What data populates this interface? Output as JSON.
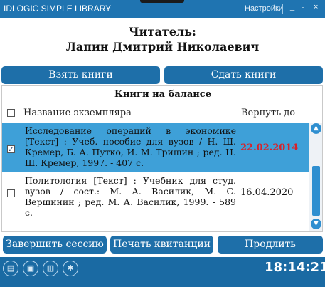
{
  "window": {
    "title": "IDLOGIC SIMPLE LIBRARY",
    "settings_label": "Настройки",
    "minimize_glyph": "_",
    "maximize_glyph": "▫",
    "close_glyph": "×"
  },
  "reader": {
    "label": "Читатель:",
    "name": "Лапин Дмитрий Николаевич"
  },
  "actions": {
    "take_books": "Взять книги",
    "return_books": "Сдать книги"
  },
  "books_panel": {
    "title": "Книги на балансе",
    "columns": {
      "name": "Название экземпляра",
      "due": "Вернуть до"
    },
    "rows": [
      {
        "title": "Исследование операций в экономике [Текст] : Учеб. пособие для вузов / Н. Ш. Кремер, Б. А. Путко, И. М. Тришин ; ред. Н. Ш. Кремер, 1997. - 407 с.",
        "due": "22.02.2014",
        "checked": true,
        "selected": true,
        "check_glyph": "✓"
      },
      {
        "title": "Политология [Текст] : Учебник для студ. вузов / сост.: М. А. Василик, М. С. Вершинин ; ред. М. А. Василик, 1999. - 589 с.",
        "due": "16.04.2020",
        "checked": false,
        "selected": false,
        "check_glyph": ""
      }
    ],
    "colors": {
      "selected_row": "#3ea0d8",
      "overdue": "#d6222a"
    }
  },
  "footer": {
    "end_session": "Завершить сессию",
    "print_receipt": "Печать квитанции",
    "extend": "Продлить"
  },
  "taskbar": {
    "icons": [
      "scanner-icon",
      "card-reader-icon",
      "printer-icon",
      "network-icon"
    ],
    "clock": "18:14:21"
  },
  "colors": {
    "brand": "#1f74b1",
    "button": "#1e6fa9",
    "taskbar": "#1a6aa3"
  }
}
